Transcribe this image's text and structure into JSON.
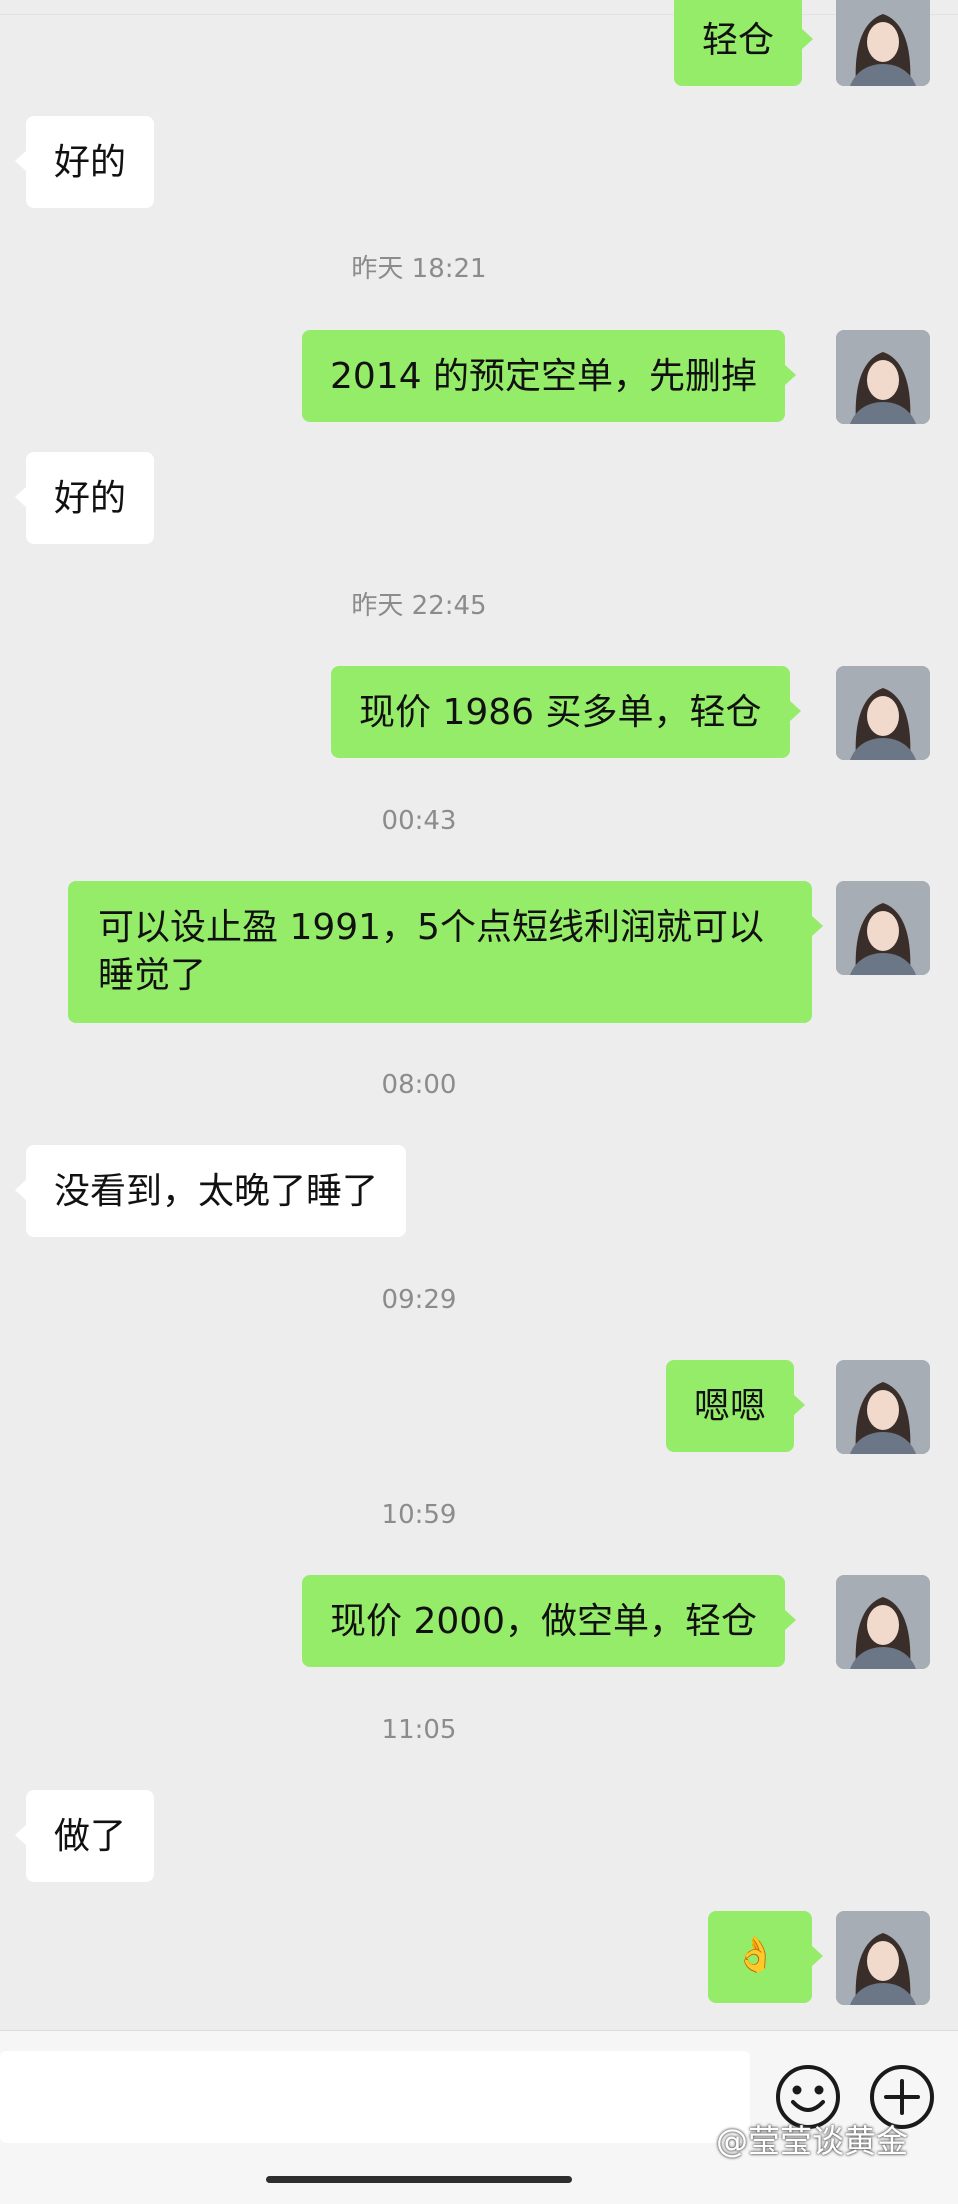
{
  "messages": [
    {
      "kind": "msg",
      "side": "right",
      "text": "轻仓"
    },
    {
      "kind": "msg",
      "side": "left",
      "text": "好的"
    },
    {
      "kind": "time",
      "text": "昨天 18:21"
    },
    {
      "kind": "msg",
      "side": "right",
      "text": "2014 的预定空单，先删掉"
    },
    {
      "kind": "msg",
      "side": "left",
      "text": "好的"
    },
    {
      "kind": "time",
      "text": "昨天 22:45"
    },
    {
      "kind": "msg",
      "side": "right",
      "text": "现价 1986 买多单，轻仓"
    },
    {
      "kind": "time",
      "text": "00:43"
    },
    {
      "kind": "msg",
      "side": "right",
      "text": "可以设止盈 1991，5个点短线利润就可以睡觉了"
    },
    {
      "kind": "time",
      "text": "08:00"
    },
    {
      "kind": "msg",
      "side": "left",
      "text": "没看到，太晚了睡了"
    },
    {
      "kind": "time",
      "text": "09:29"
    },
    {
      "kind": "msg",
      "side": "right",
      "text": "嗯嗯"
    },
    {
      "kind": "time",
      "text": "10:59"
    },
    {
      "kind": "msg",
      "side": "right",
      "text": "现价 2000，做空单，轻仓"
    },
    {
      "kind": "time",
      "text": "11:05"
    },
    {
      "kind": "msg",
      "side": "left",
      "text": "做了"
    },
    {
      "kind": "msg",
      "side": "right",
      "text": "👌"
    }
  ],
  "input_bar": {
    "input_value": "",
    "emoji_icon": "smiley-face-icon",
    "more_icon": "plus-circle-icon"
  },
  "watermark": "@莹莹谈黄金",
  "colors": {
    "background": "#ededed",
    "my_bubble": "#95ec69",
    "their_bubble": "#ffffff",
    "timestamp": "#8c8c8c"
  }
}
